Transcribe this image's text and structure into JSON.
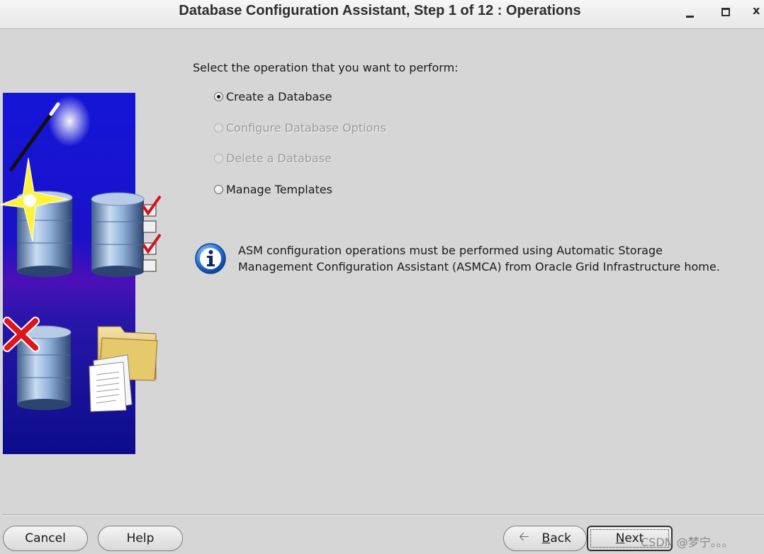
{
  "window": {
    "title": "Database Configuration Assistant, Step 1 of 12 : Operations",
    "controls": [
      "minimize-icon",
      "maximize-icon",
      "close-icon"
    ],
    "close_glyph": "x"
  },
  "wizard_illustration": {
    "icons": [
      "magic-wand-icon",
      "sparkle-icon",
      "database-icon",
      "checklist-icon",
      "delete-x-icon",
      "folder-icon",
      "documents-icon"
    ],
    "colors": {
      "background_top": "#1515d8",
      "background_mid": "#4b10b8",
      "background_bottom": "#0c0c8a",
      "check": "#d8101c",
      "x_mark": "#e0141c"
    }
  },
  "main": {
    "prompt": "Select the operation that you want to perform:",
    "options": [
      {
        "label": "Create a Database",
        "selected": true,
        "enabled": true
      },
      {
        "label": "Configure Database Options",
        "selected": false,
        "enabled": false
      },
      {
        "label": "Delete a Database",
        "selected": false,
        "enabled": false
      },
      {
        "label": "Manage Templates",
        "selected": false,
        "enabled": true
      }
    ],
    "info": {
      "icon": "info-icon",
      "line1": "ASM configuration operations must be performed using Automatic Storage",
      "line2": "Management Configuration Assistant (ASMCA) from Oracle Grid Infrastructure home."
    }
  },
  "footer": {
    "cancel": "Cancel",
    "help": "Help",
    "back_mnemonic": "B",
    "back_rest": "ack",
    "next_mnemonic": "N",
    "next_rest": "ext",
    "watermark": "CSDN @梦宁。。。"
  }
}
